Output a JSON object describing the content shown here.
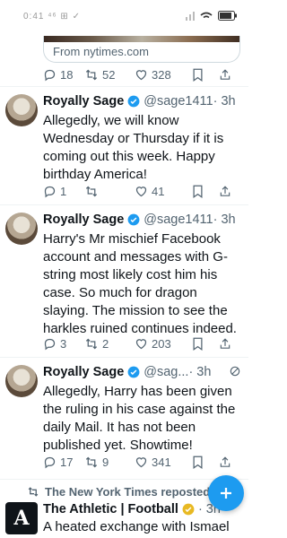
{
  "status_bar": {
    "time": "0:41 ⁴⁶ ⊞ ✓",
    "battery": ""
  },
  "link_card": {
    "source": "From nytimes.com"
  },
  "tweets": [
    {
      "stats": {
        "replies": "18",
        "reposts": "52",
        "likes": "328"
      }
    },
    {
      "name": "Royally Sage",
      "handle": "@sage1411",
      "time": "· 3h",
      "text": "Allegedly, we will know Wednesday or Thursday if it is coming out this week. Happy birthday America!",
      "stats": {
        "replies": "1",
        "reposts": "",
        "likes": "41"
      }
    },
    {
      "name": "Royally Sage",
      "handle": "@sage1411",
      "time": "· 3h",
      "text": "Harry's Mr mischief Facebook account and messages with G-string most likely cost him his case. So much for dragon slaying. The mission to see the harkles ruined continues indeed.",
      "stats": {
        "replies": "3",
        "reposts": "2",
        "likes": "203"
      }
    },
    {
      "name": "Royally Sage",
      "handle": "@sag...",
      "time": "· 3h",
      "text": "Allegedly, Harry has been given the ruling in his case against the daily Mail. It has not been published yet. Showtime!",
      "stats": {
        "replies": "17",
        "reposts": "9",
        "likes": "341"
      }
    }
  ],
  "repost": {
    "label": "The New York Times reposted"
  },
  "next_tweet": {
    "name": "The Athletic | Football",
    "time": "· 3h",
    "text": "A heated exchange with Ismael",
    "logo_letter": "A"
  },
  "colors": {
    "accent": "#1d9bf0",
    "muted": "#536471",
    "text": "#0f1419"
  }
}
